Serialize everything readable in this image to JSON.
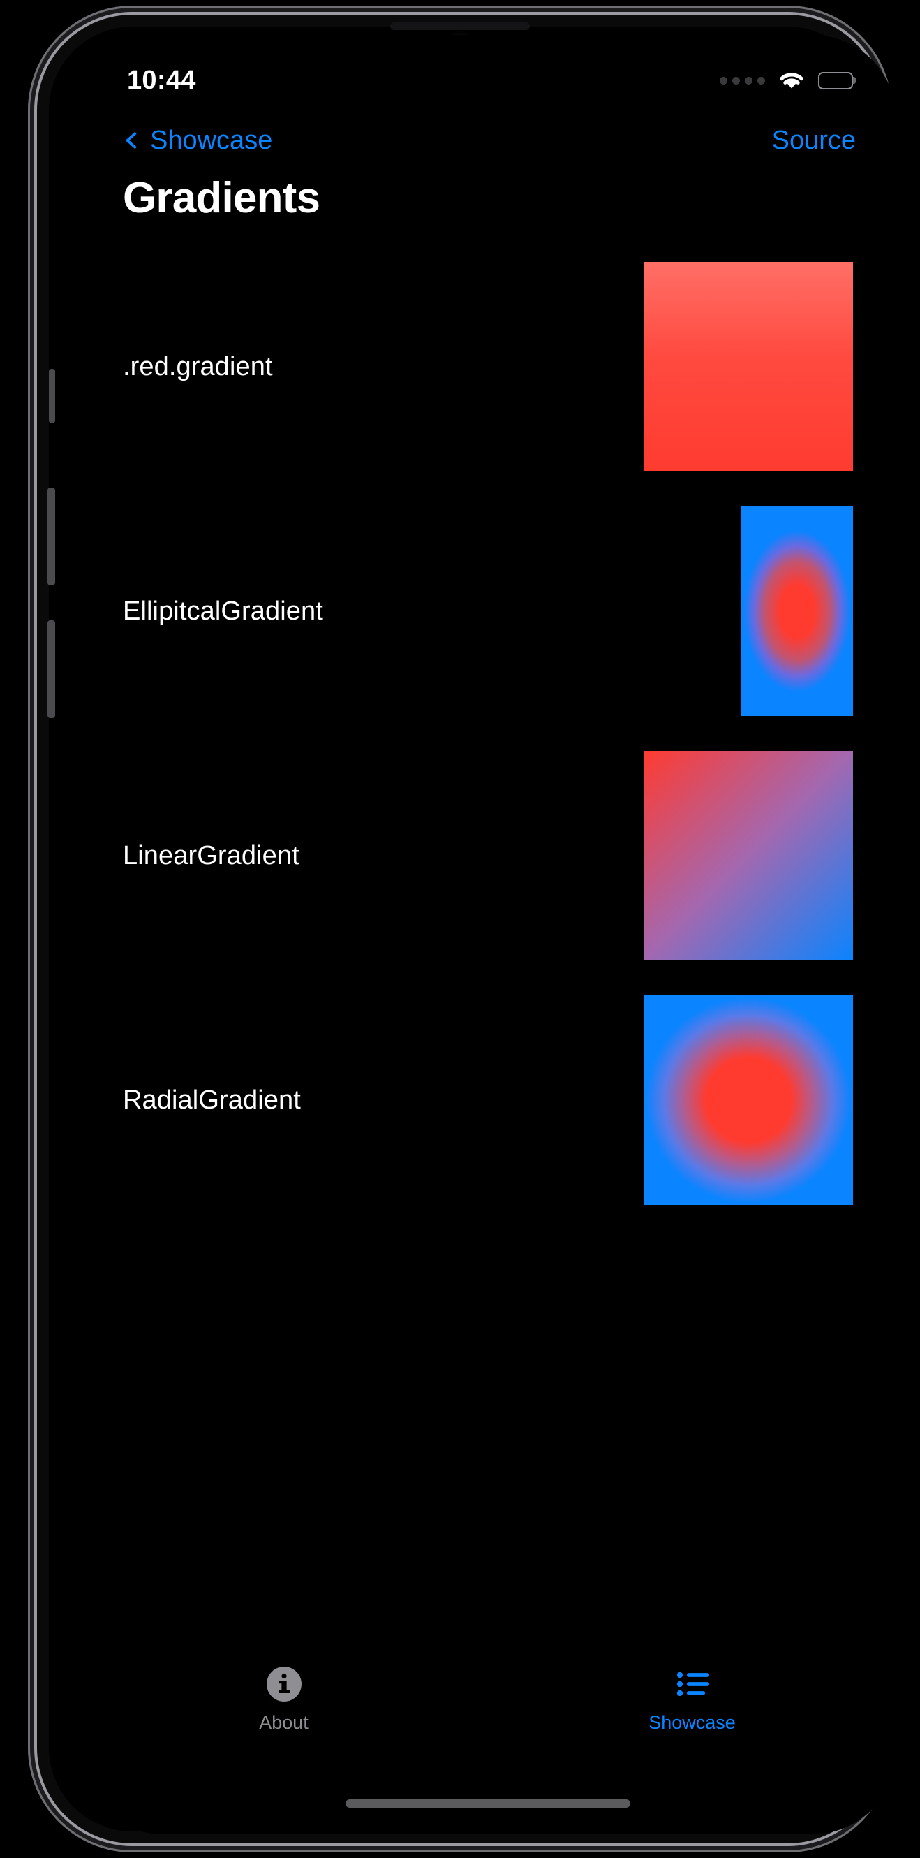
{
  "status_bar": {
    "time": "10:44",
    "signal_icon": "signal-dots-icon",
    "wifi_icon": "wifi-icon",
    "battery_icon": "battery-full-icon"
  },
  "nav_bar": {
    "back_label": "Showcase",
    "back_icon": "chevron-left-icon",
    "action_label": "Source"
  },
  "page_title": "Gradients",
  "colors": {
    "accent_blue": "#0A84FF",
    "gradient_red": "#FF3B30",
    "gradient_red_light": "#FF6F66",
    "gradient_blue": "#0A84FF",
    "background": "#000000",
    "inactive_gray": "#8E8E93"
  },
  "gradient_rows": [
    {
      "label": ".red.gradient",
      "swatch_kind": "linear-vertical",
      "swatch_class": "swatch-red",
      "colors": [
        "#FF6F66",
        "#FF3B30"
      ],
      "size": "300x300"
    },
    {
      "label": "EllipitcalGradient",
      "swatch_kind": "elliptical",
      "swatch_class": "swatch-elliptical",
      "colors": [
        "#FF3B30",
        "#0A84FF"
      ],
      "size": "160x300"
    },
    {
      "label": "LinearGradient",
      "swatch_kind": "linear-diagonal",
      "swatch_class": "swatch-linear",
      "colors": [
        "#FF3B30",
        "#0A84FF"
      ],
      "size": "300x300"
    },
    {
      "label": "RadialGradient",
      "swatch_kind": "radial",
      "swatch_class": "swatch-radial",
      "colors": [
        "#FF3B30",
        "#0A84FF"
      ],
      "size": "300x300"
    }
  ],
  "tab_bar": {
    "items": [
      {
        "label": "About",
        "icon": "info-circle-icon",
        "active": false
      },
      {
        "label": "Showcase",
        "icon": "list-bullet-icon",
        "active": true
      }
    ]
  }
}
